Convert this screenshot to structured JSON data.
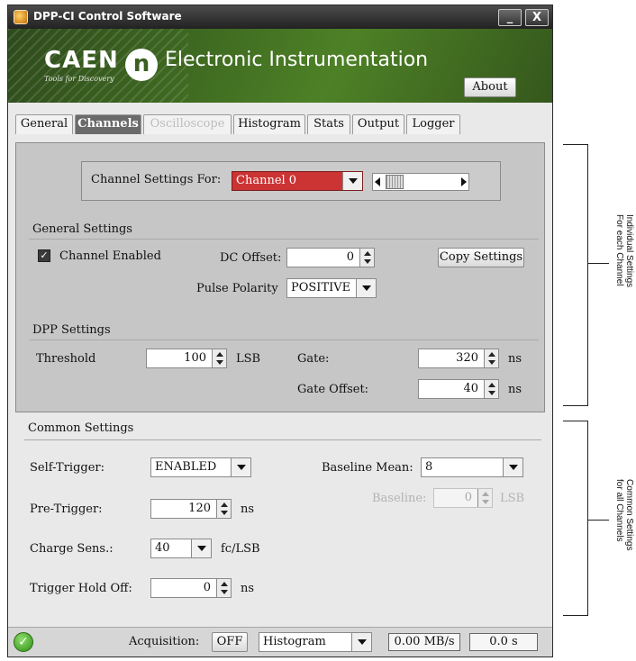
{
  "window": {
    "title": "DPP-CI Control Software",
    "minimize_glyph": "_",
    "close_glyph": "X"
  },
  "banner": {
    "brand": "CAEN",
    "tagline": "Tools for Discovery",
    "logo_letter": "n",
    "heading": "Electronic Instrumentation",
    "about_label": "About"
  },
  "tabs": [
    {
      "label": "General",
      "state": "normal"
    },
    {
      "label": "Channels",
      "state": "active"
    },
    {
      "label": "Oscilloscope",
      "state": "disabled"
    },
    {
      "label": "Histogram",
      "state": "normal"
    },
    {
      "label": "Stats",
      "state": "normal"
    },
    {
      "label": "Output",
      "state": "normal"
    },
    {
      "label": "Logger",
      "state": "normal"
    }
  ],
  "channel_selector": {
    "label": "Channel Settings For:",
    "value": "Channel 0",
    "highlight_color": "#cc3333"
  },
  "general_settings": {
    "section_title": "General Settings",
    "channel_enabled_label": "Channel Enabled",
    "channel_enabled_checked": true,
    "dc_offset_label": "DC Offset:",
    "dc_offset_value": "0",
    "copy_settings_label": "Copy Settings",
    "pulse_polarity_label": "Pulse Polarity",
    "pulse_polarity_value": "POSITIVE"
  },
  "dpp_settings": {
    "section_title": "DPP Settings",
    "threshold_label": "Threshold",
    "threshold_value": "100",
    "threshold_unit": "LSB",
    "gate_label": "Gate:",
    "gate_value": "320",
    "gate_unit": "ns",
    "gate_offset_label": "Gate Offset:",
    "gate_offset_value": "40",
    "gate_offset_unit": "ns"
  },
  "common_settings": {
    "section_title": "Common Settings",
    "self_trigger_label": "Self-Trigger:",
    "self_trigger_value": "ENABLED",
    "baseline_mean_label": "Baseline Mean:",
    "baseline_mean_value": "8",
    "baseline_label": "Baseline:",
    "baseline_value": "0",
    "baseline_unit": "LSB",
    "pre_trigger_label": "Pre-Trigger:",
    "pre_trigger_value": "120",
    "pre_trigger_unit": "ns",
    "charge_sens_label": "Charge Sens.:",
    "charge_sens_value": "40",
    "charge_sens_unit": "fc/LSB",
    "trigger_hold_off_label": "Trigger Hold Off:",
    "trigger_hold_off_value": "0",
    "trigger_hold_off_unit": "ns"
  },
  "status_bar": {
    "acquisition_label": "Acquisition:",
    "acquisition_state": "OFF",
    "mode_value": "Histogram",
    "rate_value": "0.00 MB/s",
    "time_value": "0.0 s"
  },
  "annotations": {
    "individual_line1": "Individual Settings",
    "individual_line2": "For each Channel",
    "common_line1": "Common Settings",
    "common_line2": "for all Channels"
  }
}
